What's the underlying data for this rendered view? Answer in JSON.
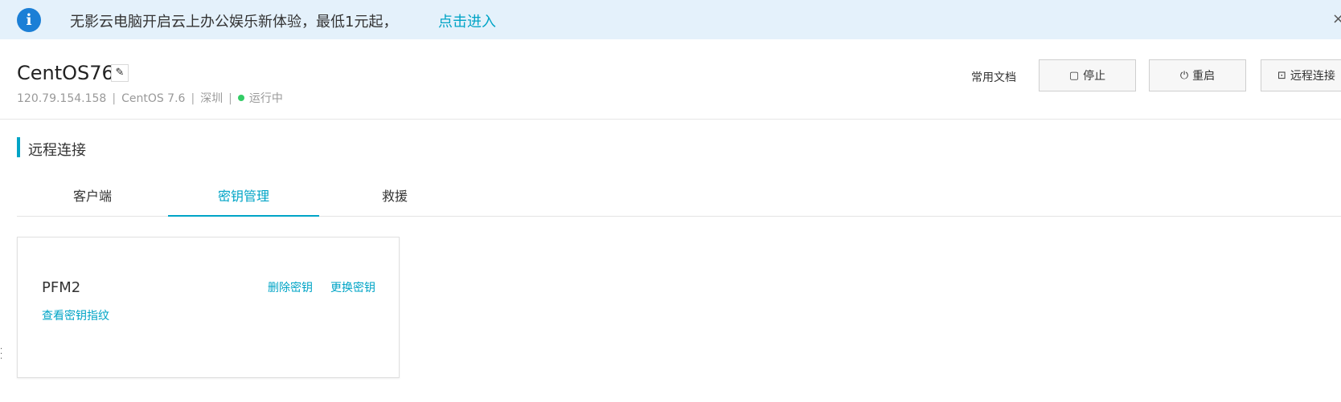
{
  "banner": {
    "message": "无影云电脑开启云上办公娱乐新体验，最低1元起，",
    "link": "点击进入",
    "close_glyph": "×",
    "icon_glyph": "i"
  },
  "instance": {
    "name": "CentOS76",
    "ip": "120.79.154.158",
    "os": "CentOS 7.6",
    "region": "深圳",
    "status": "运行中",
    "status_color": "#33cc66"
  },
  "toolbar": {
    "docs": "常用文档",
    "stop": "停止",
    "restart": "重启",
    "remote": "远程连接"
  },
  "section": {
    "title": "远程连接"
  },
  "tabs": [
    {
      "label": "客户端",
      "active": false
    },
    {
      "label": "密钥管理",
      "active": true
    },
    {
      "label": "救援",
      "active": false
    }
  ],
  "key_card": {
    "name": "PFM2",
    "delete": "删除密钥",
    "replace": "更换密钥",
    "fingerprint": "查看密钥指纹"
  },
  "colors": {
    "accent": "#00a4c6",
    "banner_bg": "#e4f1fb",
    "info_icon": "#1b7fd6"
  }
}
